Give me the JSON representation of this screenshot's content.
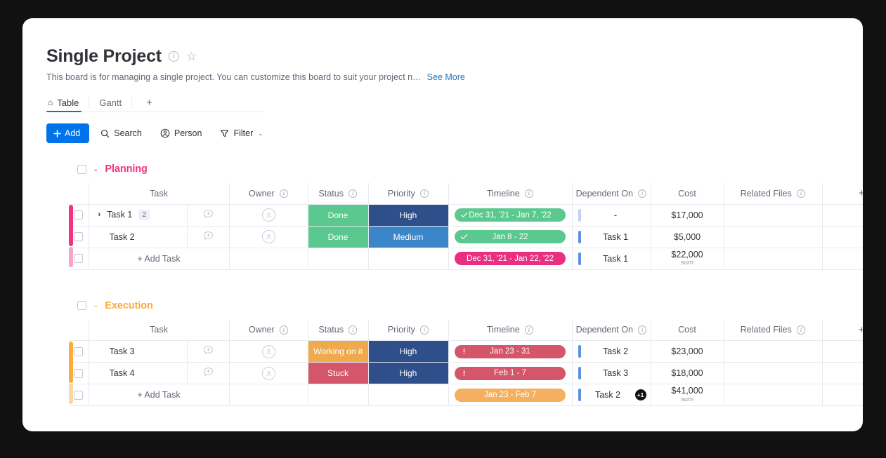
{
  "board": {
    "title": "Single Project",
    "description": "This board is for managing a single project. You can customize this board to suit your project n…",
    "see_more": "See More",
    "info_icon": "info-icon",
    "star_icon": "star-icon"
  },
  "tabs": [
    {
      "label": "Table",
      "icon": "home-icon",
      "active": true
    },
    {
      "label": "Gantt",
      "icon": "",
      "active": false
    }
  ],
  "tab_add_label": "+",
  "toolbar": {
    "add_label": "Add",
    "search_label": "Search",
    "person_label": "Person",
    "filter_label": "Filter",
    "filter_caret": "⌄"
  },
  "columns": [
    {
      "label": "Task",
      "info": false
    },
    {
      "label": "Owner",
      "info": true
    },
    {
      "label": "Status",
      "info": true
    },
    {
      "label": "Priority",
      "info": true
    },
    {
      "label": "Timeline",
      "info": true
    },
    {
      "label": "Dependent On",
      "info": true
    },
    {
      "label": "Cost",
      "info": false
    },
    {
      "label": "Related Files",
      "info": true
    }
  ],
  "add_column_label": "+",
  "add_task_label": "+ Add Task",
  "colors": {
    "accent_blue": "#0073ea",
    "planning": "#e2445c",
    "planning_group": "#f5327f",
    "execution_group": "#fdab3d",
    "done_green": "#5bc98f",
    "working_orange": "#eeaa4c",
    "stuck_red": "#d3566a",
    "high_navy": "#2e4f89",
    "medium_blue": "#3b86c9",
    "timeline_green": "#5bc98f",
    "timeline_red": "#d3566a",
    "timeline_orange": "#f4b060",
    "summary_pink": "#eb2f80",
    "dep_blue": "#5b8fe0",
    "dep_blue_light": "#bdd2f5"
  },
  "groups": [
    {
      "name": "Planning",
      "color": "#f5327f",
      "accent": "#f5327f",
      "accent_light": "#fba2c7",
      "rows": [
        {
          "task": "Task 1",
          "expandable": true,
          "subtask_count": "2",
          "owner": "",
          "status": {
            "label": "Done",
            "color": "#5bc98f"
          },
          "priority": {
            "label": "High",
            "color": "#2e4f89"
          },
          "timeline": {
            "label": "Dec 31, '21 - Jan 7, '22",
            "color": "#5bc98f",
            "icon": "check-icon"
          },
          "dependent_on": "-",
          "dep_bar_color": "#bdd2f5",
          "cost": "$17,000",
          "related_files": ""
        },
        {
          "task": "Task 2",
          "expandable": false,
          "subtask_count": "",
          "owner": "",
          "status": {
            "label": "Done",
            "color": "#5bc98f"
          },
          "priority": {
            "label": "Medium",
            "color": "#3b86c9"
          },
          "timeline": {
            "label": "Jan 8 - 22",
            "color": "#5bc98f",
            "icon": "check-icon"
          },
          "dependent_on": "Task 1",
          "dep_bar_color": "#5b8fe0",
          "cost": "$5,000",
          "related_files": ""
        }
      ],
      "summary": {
        "timeline": {
          "label": "Dec 31, '21 - Jan 22, '22",
          "color": "#eb2f80",
          "icon": ""
        },
        "dependent_on": "Task 1",
        "dep_bar_color": "#5b8fe0",
        "extra_badge": "",
        "cost_value": "$22,000",
        "cost_label": "sum"
      }
    },
    {
      "name": "Execution",
      "color": "#fdab3d",
      "accent": "#fdab3d",
      "accent_light": "#fdd69e",
      "rows": [
        {
          "task": "Task 3",
          "expandable": false,
          "subtask_count": "",
          "owner": "",
          "status": {
            "label": "Working on it",
            "color": "#eeaa4c"
          },
          "priority": {
            "label": "High",
            "color": "#2e4f89"
          },
          "timeline": {
            "label": "Jan 23 - 31",
            "color": "#d3566a",
            "icon": "alert-icon"
          },
          "dependent_on": "Task 2",
          "dep_bar_color": "#5b8fe0",
          "cost": "$23,000",
          "related_files": ""
        },
        {
          "task": "Task 4",
          "expandable": false,
          "subtask_count": "",
          "owner": "",
          "status": {
            "label": "Stuck",
            "color": "#d3566a"
          },
          "priority": {
            "label": "High",
            "color": "#2e4f89"
          },
          "timeline": {
            "label": "Feb 1 - 7",
            "color": "#d3566a",
            "icon": "alert-icon"
          },
          "dependent_on": "Task 3",
          "dep_bar_color": "#5b8fe0",
          "cost": "$18,000",
          "related_files": ""
        }
      ],
      "summary": {
        "timeline": {
          "label": "Jan 23 - Feb 7",
          "color": "#f4b060",
          "icon": ""
        },
        "dependent_on": "Task 2",
        "dep_bar_color": "#5b8fe0",
        "extra_badge": "+1",
        "cost_value": "$41,000",
        "cost_label": "sum"
      }
    }
  ]
}
